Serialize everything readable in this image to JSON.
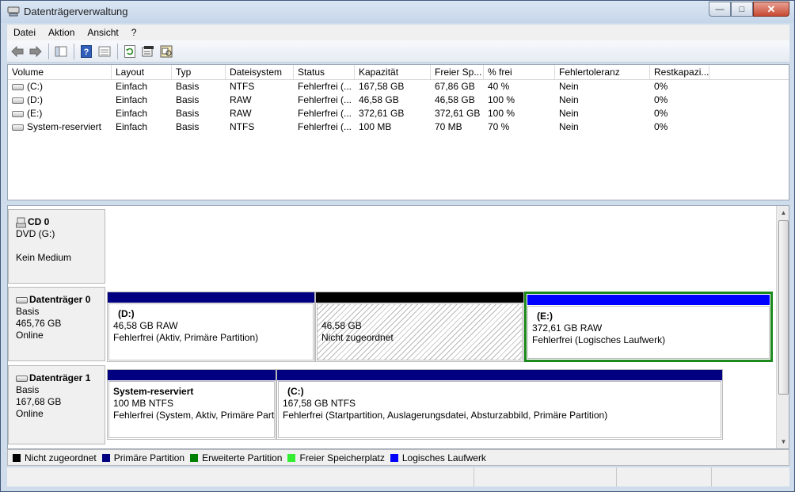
{
  "window": {
    "title": "Datenträgerverwaltung",
    "colors": {
      "accent": "#2c69c4",
      "close": "#c74a33"
    }
  },
  "menu": [
    "Datei",
    "Aktion",
    "Ansicht",
    "?"
  ],
  "toolbar": [
    "back-icon",
    "forward-icon",
    "show-hide-tree-icon",
    "help-icon",
    "properties-view-icon",
    "refresh-icon",
    "disk-properties-icon",
    "rescan-icon"
  ],
  "volumes": {
    "columns": [
      "Volume",
      "Layout",
      "Typ",
      "Dateisystem",
      "Status",
      "Kapazität",
      "Freier Sp...",
      "% frei",
      "Fehlertoleranz",
      "Restkapazi..."
    ],
    "rows": [
      [
        "(C:)",
        "Einfach",
        "Basis",
        "NTFS",
        "Fehlerfrei (...",
        "167,58 GB",
        "67,86 GB",
        "40 %",
        "Nein",
        "0%"
      ],
      [
        "(D:)",
        "Einfach",
        "Basis",
        "RAW",
        "Fehlerfrei (...",
        "46,58 GB",
        "46,58 GB",
        "100 %",
        "Nein",
        "0%"
      ],
      [
        "(E:)",
        "Einfach",
        "Basis",
        "RAW",
        "Fehlerfrei (...",
        "372,61 GB",
        "372,61 GB",
        "100 %",
        "Nein",
        "0%"
      ],
      [
        "System-reserviert",
        "Einfach",
        "Basis",
        "NTFS",
        "Fehlerfrei (...",
        "100 MB",
        "70 MB",
        "70 %",
        "Nein",
        "0%"
      ]
    ]
  },
  "disks": {
    "cd0": {
      "title": "CD 0",
      "line1": "DVD (G:)",
      "line3": "Kein Medium"
    },
    "d0": {
      "title": "Datenträger 0",
      "type": "Basis",
      "size": "465,76 GB",
      "state": "Online",
      "parts": [
        {
          "name": "(D:)",
          "size": "46,58 GB RAW",
          "status": "Fehlerfrei (Aktiv, Primäre Partition)"
        },
        {
          "name": "",
          "size": "46,58 GB",
          "status": "Nicht zugeordnet"
        },
        {
          "name": "(E:)",
          "size": "372,61 GB RAW",
          "status": "Fehlerfrei (Logisches Laufwerk)"
        }
      ]
    },
    "d1": {
      "title": "Datenträger 1",
      "type": "Basis",
      "size": "167,68 GB",
      "state": "Online",
      "parts": [
        {
          "name": "System-reserviert",
          "size": "100 MB NTFS",
          "status": "Fehlerfrei (System, Aktiv, Primäre Part"
        },
        {
          "name": "(C:)",
          "size": "167,58 GB NTFS",
          "status": "Fehlerfrei (Startpartition, Auslagerungsdatei, Absturzabbild, Primäre Partition)"
        }
      ]
    }
  },
  "legend": [
    {
      "label": "Nicht zugeordnet",
      "color": "#000000"
    },
    {
      "label": "Primäre Partition",
      "color": "#000080"
    },
    {
      "label": "Erweiterte Partition",
      "color": "#008000"
    },
    {
      "label": "Freier Speicherplatz",
      "color": "#33ee33"
    },
    {
      "label": "Logisches Laufwerk",
      "color": "#0000ff"
    }
  ]
}
